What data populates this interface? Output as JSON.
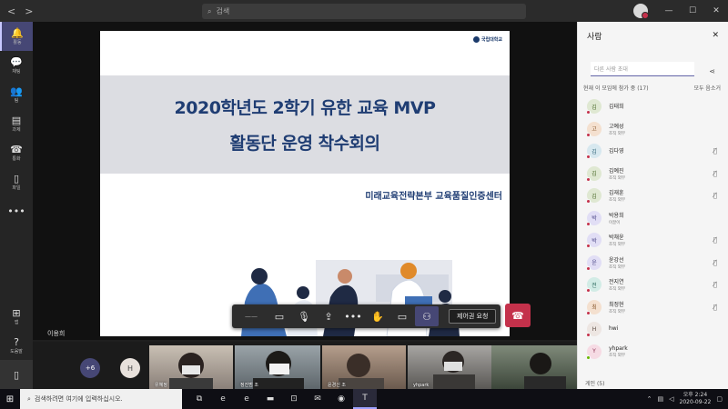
{
  "titlebar": {
    "search_placeholder": "검색",
    "nav_back": "<",
    "nav_forward": ">",
    "minimize": "—",
    "maximize": "☐",
    "close": "✕"
  },
  "rail": {
    "items": [
      {
        "label": "활동",
        "icon": "bell-icon",
        "glyph": "🔔"
      },
      {
        "label": "채팅",
        "icon": "chat-icon",
        "glyph": "💬"
      },
      {
        "label": "팀",
        "icon": "teams-icon",
        "glyph": "👥"
      },
      {
        "label": "과제",
        "icon": "assignments-icon",
        "glyph": "▤"
      },
      {
        "label": "통화",
        "icon": "calls-icon",
        "glyph": "☎"
      },
      {
        "label": "파일",
        "icon": "files-icon",
        "glyph": "▯"
      },
      {
        "label": "",
        "icon": "more-icon",
        "glyph": "•••"
      }
    ],
    "bottom": [
      {
        "label": "앱",
        "icon": "apps-icon",
        "glyph": "⊞"
      },
      {
        "label": "도움말",
        "icon": "help-icon",
        "glyph": "?"
      },
      {
        "label": "",
        "icon": "device-icon",
        "glyph": "▯"
      }
    ]
  },
  "slide": {
    "logo_text": "국립대학교",
    "title_line1": "2020학년도 2학기 유한 교육 MVP",
    "title_line2": "활동단 운영 착수회의",
    "subtitle": "미래교육전략본부 교육품질인증센터"
  },
  "presenter": {
    "name": "이용희"
  },
  "callbar": {
    "timer": "——",
    "share_request": "제어권 요청",
    "buttons": [
      {
        "icon": "camera-icon",
        "glyph": "▭"
      },
      {
        "icon": "mic-icon",
        "glyph": "🎙"
      },
      {
        "icon": "share-screen-icon",
        "glyph": "⇪"
      },
      {
        "icon": "more-options-icon",
        "glyph": "•••"
      },
      {
        "icon": "raise-hand-icon",
        "glyph": "✋"
      },
      {
        "icon": "chat-panel-icon",
        "glyph": "▭"
      },
      {
        "icon": "participants-icon",
        "glyph": "⚇"
      }
    ],
    "hangup_glyph": "☎"
  },
  "gallery": {
    "more_count": "+6",
    "h_avatar": "H",
    "tiles": [
      {
        "name": "유혜정"
      },
      {
        "name": "정진범 조"
      },
      {
        "name": "윤경신 조"
      },
      {
        "name": "yhpark"
      },
      {
        "name": ""
      }
    ]
  },
  "panel": {
    "title": "사람",
    "close": "✕",
    "search_placeholder": "다른 사람 초대",
    "section_label": "현재 이 모임에 참가 중 (17)",
    "mute_all": "모두 음소거",
    "participants": [
      {
        "name": "김태희",
        "role": "",
        "initial": "김",
        "bg": "#dfe8d2",
        "fg": "#4a6b2a",
        "status": "#c4314b",
        "mic": false
      },
      {
        "name": "고예성",
        "role": "조직 외부",
        "initial": "고",
        "bg": "#f4e0cf",
        "fg": "#8a5a30",
        "status": "#c4314b",
        "mic": false
      },
      {
        "name": "김다영",
        "role": "",
        "initial": "김",
        "bg": "#d7e8ef",
        "fg": "#2e6478",
        "status": "#c4314b",
        "mic": true
      },
      {
        "name": "김예진",
        "role": "조직 외부",
        "initial": "김",
        "bg": "#dfe8d2",
        "fg": "#4a6b2a",
        "status": "#c4314b",
        "mic": true
      },
      {
        "name": "김재훈",
        "role": "조직 외부",
        "initial": "김",
        "bg": "#dfe8d2",
        "fg": "#4a6b2a",
        "status": "#c4314b",
        "mic": true
      },
      {
        "name": "박용희",
        "role": "이끌이",
        "initial": "박",
        "bg": "#e1def5",
        "fg": "#4e4a8a",
        "status": "#c4314b",
        "mic": false
      },
      {
        "name": "박채윤",
        "role": "조직 외부",
        "initial": "박",
        "bg": "#e1def5",
        "fg": "#4e4a8a",
        "status": "#c4314b",
        "mic": true
      },
      {
        "name": "윤강선",
        "role": "조직 외부",
        "initial": "윤",
        "bg": "#e1def5",
        "fg": "#4e4a8a",
        "status": "#c4314b",
        "mic": true
      },
      {
        "name": "전지연",
        "role": "조직 외부",
        "initial": "전",
        "bg": "#d2ece6",
        "fg": "#2c6a5e",
        "status": "#c4314b",
        "mic": true
      },
      {
        "name": "최정현",
        "role": "조직 외부",
        "initial": "최",
        "bg": "#f4e0cf",
        "fg": "#8a5a30",
        "status": "#c4314b",
        "mic": true
      },
      {
        "name": "hwi",
        "role": "",
        "initial": "H",
        "bg": "#ede6e2",
        "fg": "#5a4a42",
        "status": "#c4314b",
        "mic": false
      },
      {
        "name": "yhpark",
        "role": "조직 외부",
        "initial": "Y",
        "bg": "#f6dbe4",
        "fg": "#8a3050",
        "status": "#6bb700",
        "mic": false
      }
    ],
    "guests_label": "게인 (5)"
  },
  "taskbar": {
    "search_placeholder": "검색하려면 여기에 입력하십시오.",
    "icons": [
      {
        "icon": "task-view-icon",
        "glyph": "⧉"
      },
      {
        "icon": "edge-icon",
        "glyph": "e"
      },
      {
        "icon": "ie-icon",
        "glyph": "e"
      },
      {
        "icon": "explorer-icon",
        "glyph": "▬"
      },
      {
        "icon": "store-icon",
        "glyph": "⊡"
      },
      {
        "icon": "mail-icon",
        "glyph": "✉"
      },
      {
        "icon": "chrome-icon",
        "glyph": "◉"
      },
      {
        "icon": "teams-taskbar-icon",
        "glyph": "T"
      }
    ],
    "time": "오후 2:24",
    "date": "2020-09-22"
  },
  "colors": {
    "accent": "#464775",
    "hangup": "#c4314b",
    "slide_title": "#1f3d73"
  }
}
